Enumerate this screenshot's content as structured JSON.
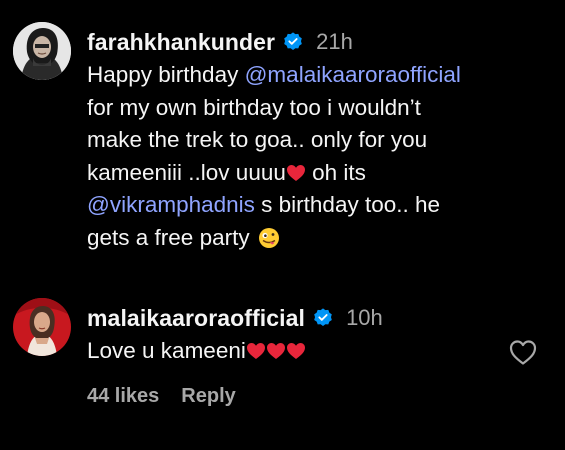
{
  "comments": [
    {
      "username": "farahkhankunder",
      "time": "21h",
      "verified": true,
      "text": {
        "l1_pre": "Happy birthday ",
        "l1_mention": "@malaikaaroraofficial",
        "l2": "for my own birthday too i wouldn’t",
        "l3": "make the trek to goa.. only for you",
        "l4_pre": "kameeniii ..lov uuuu",
        "l4_post": " oh its",
        "l5_mention": "@vikramphadnis",
        "l5_post": " s birthday too.. he",
        "l6": "gets a free party"
      },
      "emojis": [
        "red-heart",
        "zany-face"
      ]
    },
    {
      "username": "malaikaaroraofficial",
      "time": "10h",
      "verified": true,
      "text": "Love u kameeni",
      "emojis": [
        "red-heart",
        "red-heart",
        "red-heart"
      ],
      "likes": "44 likes",
      "reply_label": "Reply"
    }
  ],
  "colors": {
    "background": "#000000",
    "text": "#f5f5f5",
    "secondary": "#a8a8a8",
    "mention": "#8fa4ff",
    "verified": "#0095f6",
    "heart": "#e0245e"
  },
  "icons": [
    "verified-badge-icon",
    "heart-outline-icon",
    "red-heart-emoji",
    "zany-face-emoji"
  ]
}
